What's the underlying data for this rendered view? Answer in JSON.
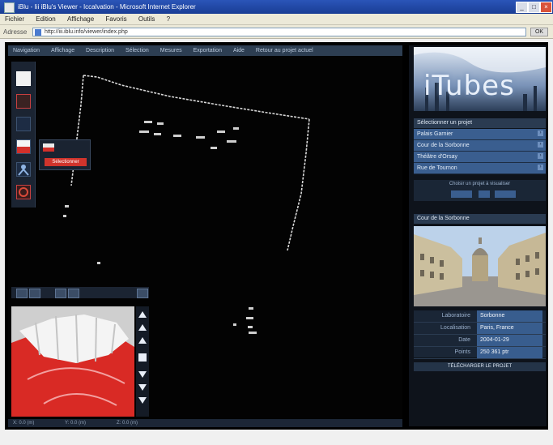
{
  "browser": {
    "title": "iBlu - Iii iBlu's Viewer - Iccalvation - Microsoft Internet Explorer",
    "menu": [
      "Fichier",
      "Edition",
      "Affichage",
      "Favoris",
      "Outils",
      "?"
    ],
    "address_label": "Adresse",
    "address_value": "http://iii.iblu.info/viewer/index.php",
    "go_label": "OK"
  },
  "app": {
    "nav": [
      "Navigation",
      "Affichage",
      "Description",
      "Sélection",
      "Mesures",
      "Exportation",
      "Aide",
      "Retour au projet actuel"
    ],
    "popup_button": "Sélectionner",
    "status": [
      "X: 0.0 (m)",
      "Y: 0.0 (m)",
      "Z: 0.0 (m)"
    ],
    "toolbar_icons": [
      "wrench-icon",
      "red-tool-icon",
      "blue-tool-icon",
      "flag-icon",
      "person-icon",
      "target-icon"
    ],
    "minimap_arrows": [
      "arrow-up-icon",
      "arrow-up-icon",
      "arrow-up-icon",
      "stop-icon",
      "arrow-down-icon",
      "arrow-down-icon",
      "arrow-down-icon"
    ]
  },
  "right": {
    "brand": "iTubes",
    "section1_title": "Sélectionner un projet",
    "projects": [
      "Palais Garnier",
      "Cour de la Sorbonne",
      "Théâtre d'Orsay",
      "Rue de Tournon"
    ],
    "pager_label": "Choisir un projet à visualiser",
    "section2_title": "Cour de la Sorbonne",
    "info": [
      {
        "k": "Laboratoire",
        "v": "Sorbonne"
      },
      {
        "k": "Localisation",
        "v": "Paris, France"
      },
      {
        "k": "Date",
        "v": "2004-01-29"
      },
      {
        "k": "Points",
        "v": "250 361 ptr"
      }
    ],
    "download": "TÉLÉCHARGER LE PROJET"
  },
  "colors": {
    "panel_blue": "#3a5e8f",
    "accent_red": "#d0342c",
    "titlebar": "#2b55b8"
  }
}
